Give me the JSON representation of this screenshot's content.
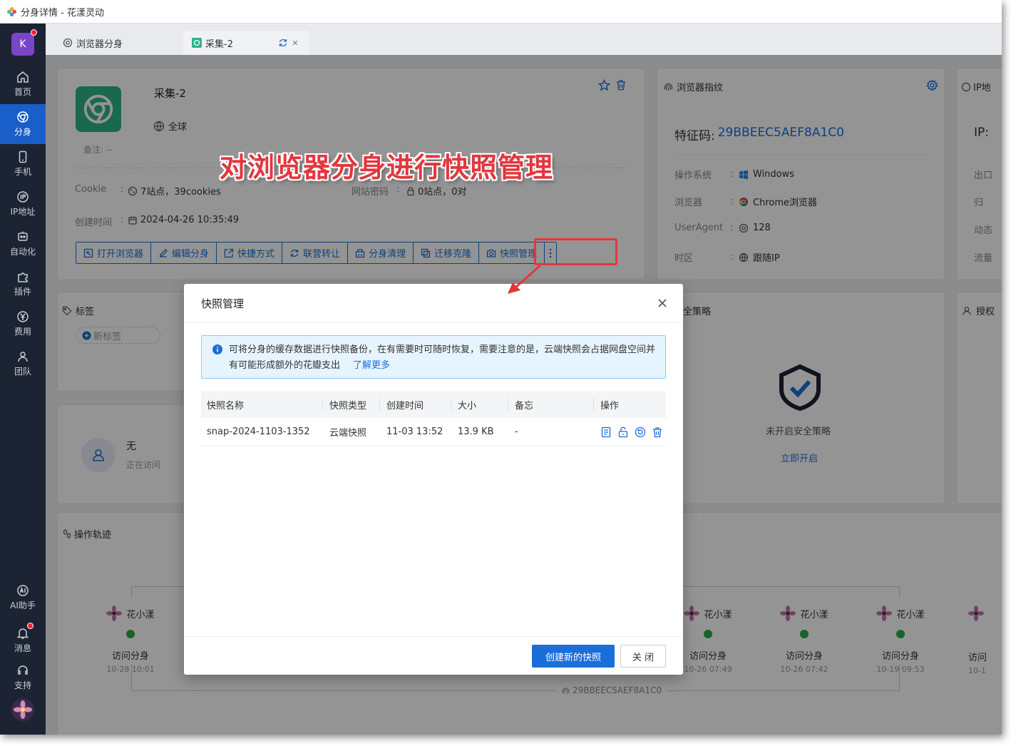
{
  "window": {
    "title": "分身详情 - 花漾灵动"
  },
  "sidebar": {
    "avatar_letter": "K",
    "items": [
      {
        "label": "首页",
        "icon": "home-icon"
      },
      {
        "label": "分身",
        "icon": "chrome-icon"
      },
      {
        "label": "手机",
        "icon": "phone-icon"
      },
      {
        "label": "IP地址",
        "icon": "ip-icon"
      },
      {
        "label": "自动化",
        "icon": "robot-icon"
      },
      {
        "label": "插件",
        "icon": "puzzle-icon"
      },
      {
        "label": "费用",
        "icon": "yen-icon"
      },
      {
        "label": "团队",
        "icon": "team-icon"
      }
    ],
    "bottom_items": [
      {
        "label": "AI助手",
        "icon": "ai-icon"
      },
      {
        "label": "消息",
        "icon": "bell-icon"
      },
      {
        "label": "支持",
        "icon": "headset-icon"
      }
    ]
  },
  "tabs": [
    {
      "label": "浏览器分身",
      "icon": "chrome-icon"
    },
    {
      "label": "采集-2",
      "icon": "chrome-icon"
    }
  ],
  "profile": {
    "name": "采集-2",
    "region": "全球",
    "remark": "备注: --",
    "cookie_label": "Cookie",
    "cookie_value": "7站点，39cookies",
    "pwd_label": "网站密码",
    "pwd_value": "0站点，0对",
    "created_label": "创建时间",
    "created_value": "2024-04-26 10:35:49",
    "actions": [
      "打开浏览器",
      "编辑分身",
      "快捷方式",
      "联营转让",
      "分身清理",
      "迁移克隆",
      "快照管理"
    ]
  },
  "fingerprint": {
    "title": "浏览器指纹",
    "code_label": "特征码:",
    "code": "29BBEEC5AEF8A1C0",
    "rows": [
      {
        "k": "操作系统",
        "v": "Windows",
        "icon": "windows-icon"
      },
      {
        "k": "浏览器",
        "v": "Chrome浏览器",
        "icon": "chrome-icon"
      },
      {
        "k": "UserAgent",
        "v": "128",
        "icon": "chrome-icon"
      },
      {
        "k": "时区",
        "v": "跟随IP",
        "icon": "globe-icon"
      }
    ]
  },
  "ip_panel": {
    "title": "IP地",
    "ip_label": "IP:",
    "rows": [
      "出口",
      "归",
      "动态",
      "流量"
    ]
  },
  "tags": {
    "title": "标签",
    "new_tag": "新标签"
  },
  "security": {
    "title": "全策略",
    "status": "未开启安全策略",
    "link": "立即开启"
  },
  "operator_panel": {
    "title": "授权"
  },
  "visitor": {
    "name": "无",
    "status": "正在访问"
  },
  "trail": {
    "title": "操作轨迹",
    "footer_code": "29BBEEC5AEF8A1C0",
    "nodes": [
      {
        "who": "花小漾",
        "action": "访问分身",
        "time": "10-28 10:01"
      },
      {
        "who": "花小漾",
        "action": "访问分身",
        "time": "10-26 07:49"
      },
      {
        "who": "花小漾",
        "action": "访问分身",
        "time": "10-26 07:42"
      },
      {
        "who": "花小漾",
        "action": "访问分身",
        "time": "10-19 09:53"
      },
      {
        "who": "",
        "action": "访问",
        "time": "10-1"
      }
    ]
  },
  "annotation": {
    "text": "对浏览器分身进行快照管理"
  },
  "modal": {
    "title": "快照管理",
    "notice": "可将分身的缓存数据进行快照备份，在有需要时可随时恢复，需要注意的是，云端快照会占据网盘空间并有可能形成额外的花瓣支出",
    "learn_more": "了解更多",
    "columns": [
      "快照名称",
      "快照类型",
      "创建时间",
      "大小",
      "备忘",
      "操作"
    ],
    "rows": [
      {
        "name": "snap-2024-1103-1352",
        "type": "云端快照",
        "created": "11-03 13:52",
        "size": "13.9 KB",
        "memo": "-"
      }
    ],
    "create_button": "创建新的快照",
    "close_button": "关 闭"
  }
}
